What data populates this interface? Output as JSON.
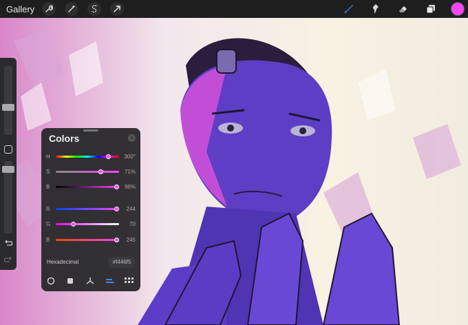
{
  "app": {
    "gallery_label": "Gallery"
  },
  "toolbar_left": [
    {
      "name": "wrench-icon"
    },
    {
      "name": "magic-wand-icon"
    },
    {
      "name": "selection-s-icon"
    },
    {
      "name": "transform-arrow-icon"
    }
  ],
  "toolbar_right": [
    {
      "name": "brush-icon",
      "active": true
    },
    {
      "name": "smudge-icon"
    },
    {
      "name": "eraser-icon"
    },
    {
      "name": "layers-icon"
    }
  ],
  "current_color": "#f446f5",
  "colors_panel": {
    "title": "Colors",
    "hsb": [
      {
        "label": "H",
        "value": "300°",
        "fraction": 0.833
      },
      {
        "label": "S",
        "value": "71%",
        "fraction": 0.71
      },
      {
        "label": "B",
        "value": "96%",
        "fraction": 0.96
      }
    ],
    "rgb": [
      {
        "label": "R",
        "value": "244",
        "fraction": 0.957
      },
      {
        "label": "G",
        "value": "70",
        "fraction": 0.275
      },
      {
        "label": "B",
        "value": "245",
        "fraction": 0.961
      }
    ],
    "hex_label": "Hexadecimal",
    "hex_value": "#f446f5",
    "tabs": [
      "disc-icon",
      "square-icon",
      "harmony-icon",
      "value-icon",
      "palettes-icon"
    ],
    "active_tab": 3
  },
  "sidebar": {
    "brush_size": 0.2,
    "opacity": 0.55
  }
}
